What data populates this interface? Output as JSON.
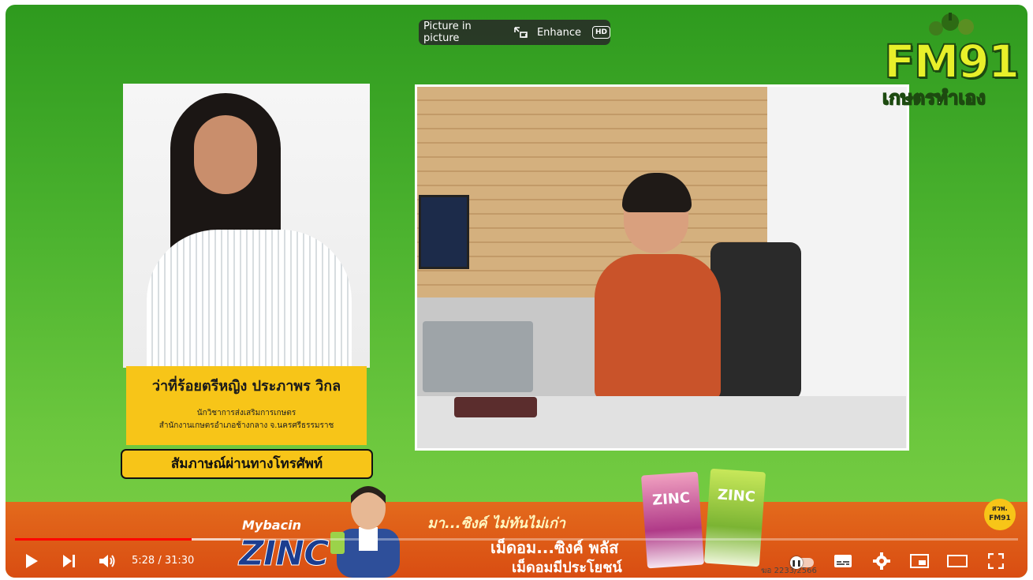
{
  "overlay": {
    "pip_label": "Picture in picture",
    "enhance_label": "Enhance",
    "hd_badge": "HD"
  },
  "logo": {
    "main": "FM91",
    "sub": "เกษตรทำเอง"
  },
  "guest": {
    "name": "ว่าที่ร้อยตรีหญิง ประภาพร วิกล",
    "role": "นักวิชาการส่งเสริมการเกษตร",
    "office": "สำนักงานเกษตรอำเภอช้างกลาง จ.นครศรีธรรมราช",
    "phone_label": "สัมภาษณ์ผ่านทางโทรศัพท์"
  },
  "ad": {
    "brand_top": "Mybacin",
    "brand_main": "ZINC",
    "slogan1": "มา...ซิงค์ ไม่ทันไม่เก่า",
    "slogan2": "เม็ดอม...ซิงค์ พลัส",
    "slogan3": "เม็ดอมมีประโยชน์",
    "pack_label": "ZINC",
    "badge": "สวพ. FM91",
    "reg_code": "ฆอ 2233/2566"
  },
  "player": {
    "time": "5:28 / 31:30",
    "progress_played": 0.176,
    "progress_buffered": 0.225,
    "icons": [
      "play-icon",
      "next-icon",
      "volume-icon",
      "autoplay-toggle",
      "subtitles-icon",
      "gear-icon",
      "miniplayer-icon",
      "theater-icon",
      "fullscreen-icon"
    ]
  }
}
